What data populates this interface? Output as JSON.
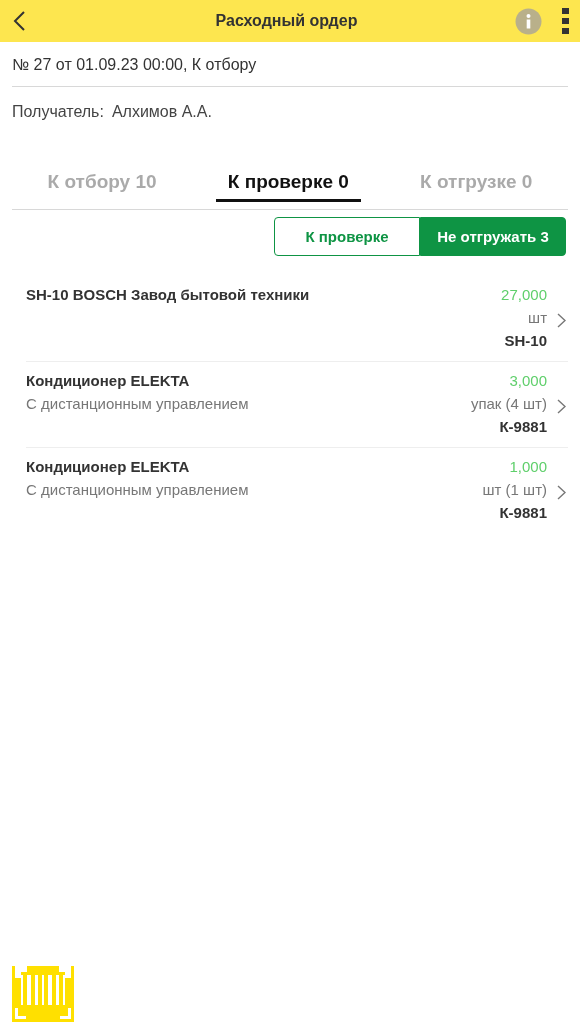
{
  "header": {
    "title": "Расходный ордер"
  },
  "document": {
    "number_line": "№ 27 от 01.09.23 00:00, К отбору",
    "recipient_label": "Получатель:",
    "recipient": "Алхимов А.А."
  },
  "tabs": [
    {
      "label": "К отбору 10",
      "selected": false
    },
    {
      "label": "К проверке 0",
      "selected": true
    },
    {
      "label": "К отгрузке 0",
      "selected": false
    }
  ],
  "filter_buttons": [
    {
      "label": "К проверке",
      "selected": false
    },
    {
      "label": "Не отгружать 3",
      "selected": true
    }
  ],
  "items": [
    {
      "name": "SH-10 BOSCH Завод бытовой техники",
      "quantity": "27,000",
      "unit": "шт",
      "article": "SH-10"
    },
    {
      "name": "Кондиционер ELEKTA",
      "description": "С дистанционным управлением",
      "quantity": "3,000",
      "unit": "упак (4 шт)",
      "article": "К-9881"
    },
    {
      "name": "Кондиционер ELEKTA",
      "description": "С дистанционным управлением",
      "quantity": "1,000",
      "unit": "шт (1 шт)",
      "article": "К-9881"
    }
  ]
}
